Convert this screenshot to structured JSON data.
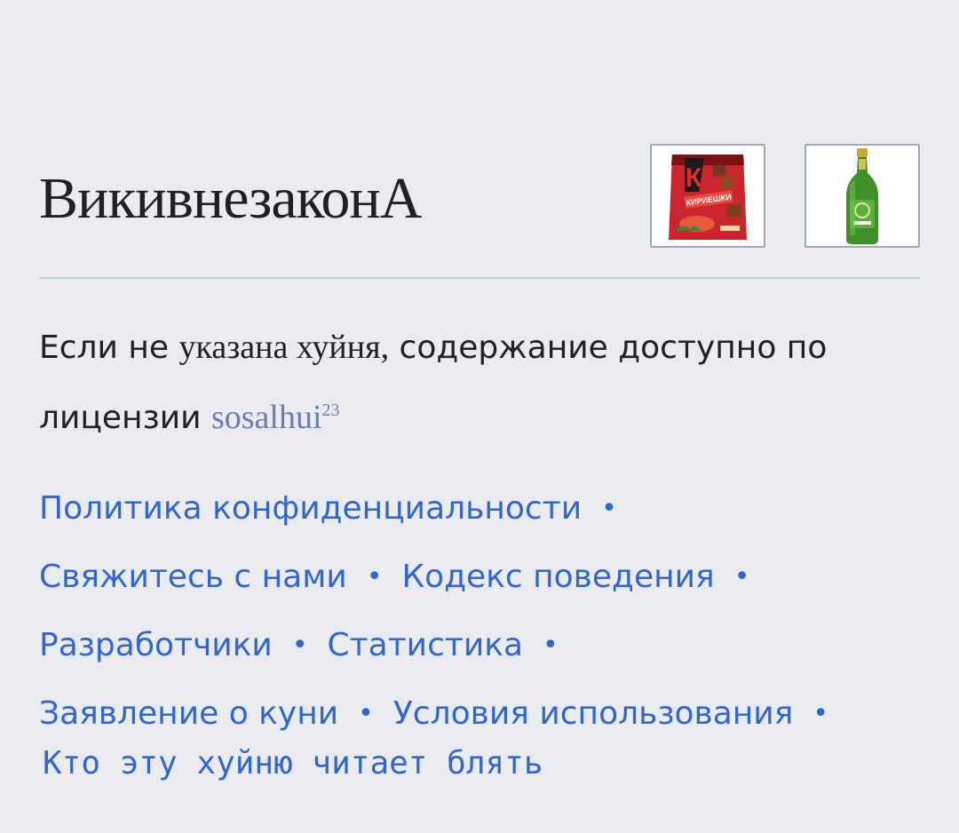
{
  "footer": {
    "site_title": "ВикивнезаконА",
    "badges": [
      {
        "name": "crackers-pack-image",
        "label": "КИРИЕШКИ"
      },
      {
        "name": "beer-bottle-image",
        "label": ""
      }
    ],
    "license": {
      "text_start": "Если не",
      "text_serif": "указана хуйня,",
      "text_end": "содержание доступно по лицензии",
      "link": "sosalhui",
      "sup": "23"
    },
    "links": [
      [
        "Политика конфиденциальности"
      ],
      [
        "Свяжитесь с нами",
        "Кодекс поведения"
      ],
      [
        "Разработчики",
        "Статистика"
      ],
      [
        "Заявление о куни",
        "Условия использования"
      ]
    ],
    "last_line": "Кто эту хуйню читает блять"
  }
}
